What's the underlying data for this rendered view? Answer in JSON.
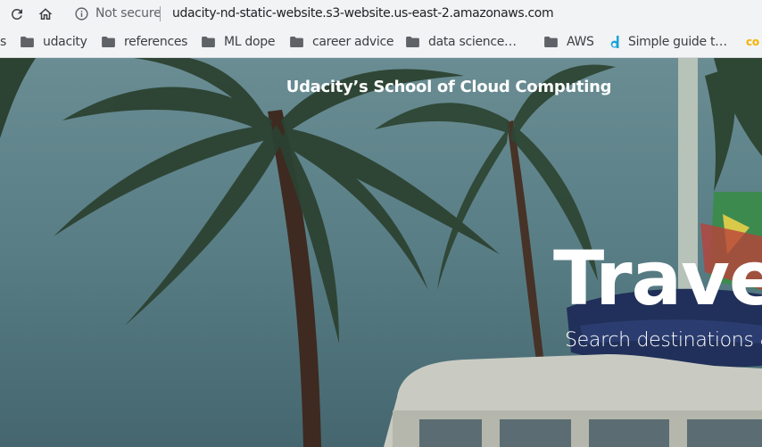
{
  "browser": {
    "security_label": "Not secure",
    "url": "udacity-nd-static-website.s3-website.us-east-2.amazonaws.com"
  },
  "bookmarks": {
    "partial_label": "s",
    "items": [
      {
        "label": "udacity",
        "icon": "folder-icon"
      },
      {
        "label": "references",
        "icon": "folder-icon"
      },
      {
        "label": "ML dope",
        "icon": "folder-icon"
      },
      {
        "label": "career advice",
        "icon": "folder-icon"
      },
      {
        "label": "data science…",
        "icon": "folder-icon"
      },
      {
        "label": "AWS",
        "icon": "folder-icon"
      },
      {
        "label": "Simple guide t…",
        "icon": "d-logo-icon"
      }
    ],
    "overflow_icon_text": "co"
  },
  "hero": {
    "site_title": "Udacity’s School of Cloud Computing",
    "heading": "Trave",
    "subheading": "Search destinations &"
  }
}
